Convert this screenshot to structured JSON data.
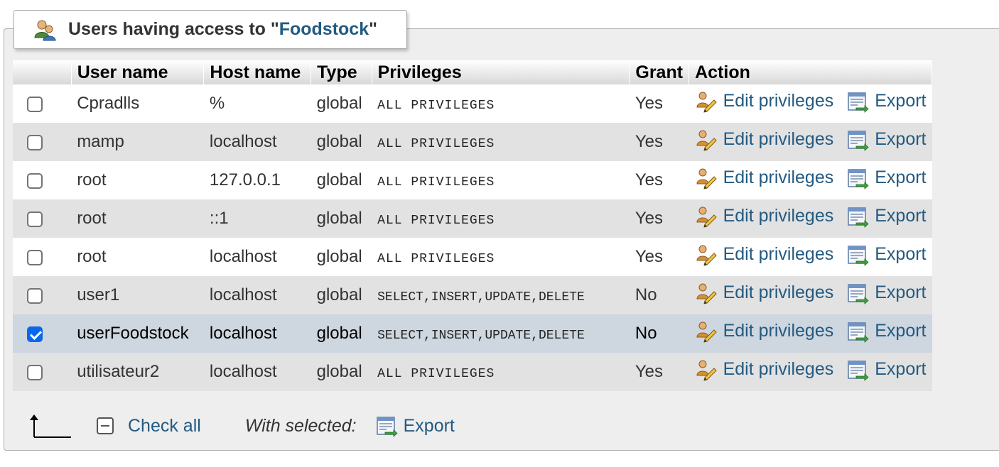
{
  "legend": {
    "prefix": "Users having access to \"",
    "db": "Foodstock",
    "suffix": "\""
  },
  "columns": {
    "user": "User name",
    "host": "Host name",
    "type": "Type",
    "privileges": "Privileges",
    "grant": "Grant",
    "action": "Action"
  },
  "actions": {
    "edit": "Edit privileges",
    "export": "Export"
  },
  "rows": [
    {
      "user": "Cpradlls",
      "host": "%",
      "type": "global",
      "privileges": "ALL PRIVILEGES",
      "grant": "Yes",
      "checked": false
    },
    {
      "user": "mamp",
      "host": "localhost",
      "type": "global",
      "privileges": "ALL PRIVILEGES",
      "grant": "Yes",
      "checked": false
    },
    {
      "user": "root",
      "host": "127.0.0.1",
      "type": "global",
      "privileges": "ALL PRIVILEGES",
      "grant": "Yes",
      "checked": false
    },
    {
      "user": "root",
      "host": "::1",
      "type": "global",
      "privileges": "ALL PRIVILEGES",
      "grant": "Yes",
      "checked": false
    },
    {
      "user": "root",
      "host": "localhost",
      "type": "global",
      "privileges": "ALL PRIVILEGES",
      "grant": "Yes",
      "checked": false
    },
    {
      "user": "user1",
      "host": "localhost",
      "type": "global",
      "privileges": "SELECT,INSERT,UPDATE,DELETE",
      "grant": "No",
      "checked": false
    },
    {
      "user": "userFoodstock",
      "host": "localhost",
      "type": "global",
      "privileges": "SELECT,INSERT,UPDATE,DELETE",
      "grant": "No",
      "checked": true
    },
    {
      "user": "utilisateur2",
      "host": "localhost",
      "type": "global",
      "privileges": "ALL PRIVILEGES",
      "grant": "Yes",
      "checked": false
    }
  ],
  "footer": {
    "check_all": "Check all",
    "with_selected": "With selected:",
    "export": "Export"
  }
}
